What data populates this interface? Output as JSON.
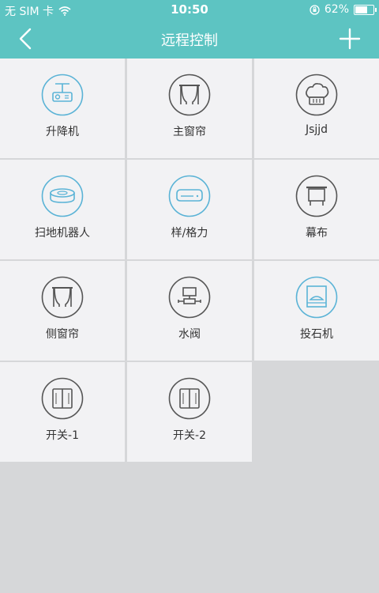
{
  "status": {
    "carrier": "无 SIM 卡",
    "time": "10:50",
    "battery": "62%"
  },
  "nav": {
    "title": "远程控制"
  },
  "devices": [
    {
      "label": "升降机",
      "icon": "projector-lift-icon",
      "color": "#5ab3d6"
    },
    {
      "label": "主窗帘",
      "icon": "curtain-icon",
      "color": "#555555"
    },
    {
      "label": "Jsjjd",
      "icon": "chef-hat-icon",
      "color": "#555555"
    },
    {
      "label": "扫地机器人",
      "icon": "robot-vacuum-icon",
      "color": "#5ab3d6"
    },
    {
      "label": "样/格力",
      "icon": "air-conditioner-icon",
      "color": "#5ab3d6"
    },
    {
      "label": "幕布",
      "icon": "projection-screen-icon",
      "color": "#555555"
    },
    {
      "label": "侧窗帘",
      "icon": "curtain-icon",
      "color": "#555555"
    },
    {
      "label": "水阀",
      "icon": "water-valve-icon",
      "color": "#555555"
    },
    {
      "label": "投石机",
      "icon": "wall-projector-icon",
      "color": "#5ab3d6"
    },
    {
      "label": "开关-1",
      "icon": "double-switch-icon",
      "color": "#555555"
    },
    {
      "label": "开关-2",
      "icon": "double-switch-icon",
      "color": "#555555"
    }
  ]
}
